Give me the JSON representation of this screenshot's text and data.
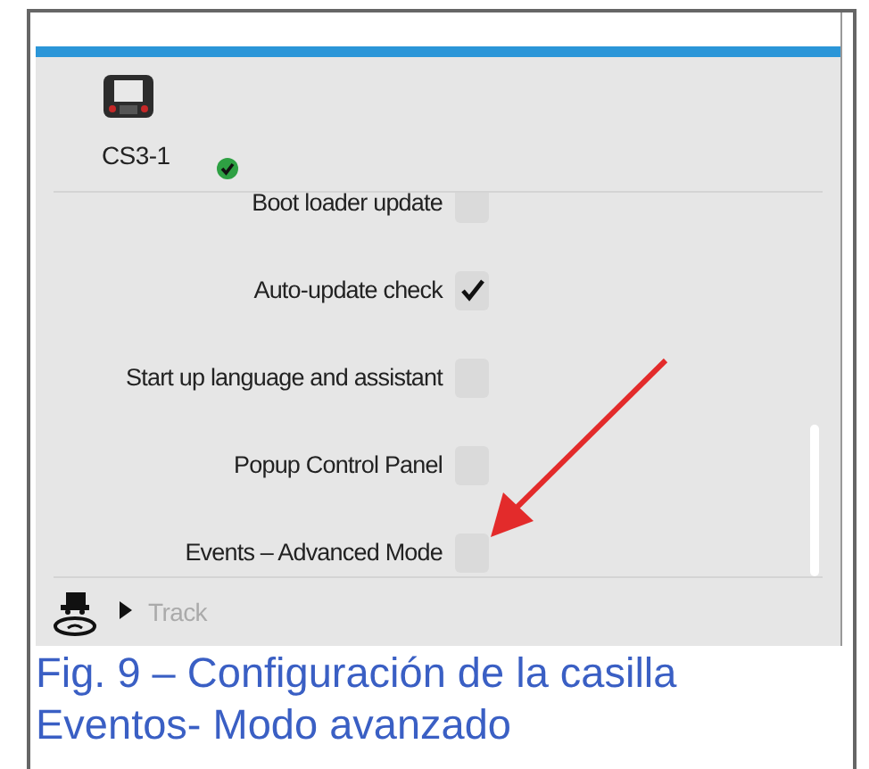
{
  "device": {
    "name": "CS3-1",
    "connected": true
  },
  "settings": [
    {
      "label": "Boot loader update",
      "checked": false
    },
    {
      "label": "Auto-update check",
      "checked": true
    },
    {
      "label": "Start up language and assistant",
      "checked": false
    },
    {
      "label": "Popup Control Panel",
      "checked": false
    },
    {
      "label": "Events – Advanced Mode",
      "checked": false
    }
  ],
  "nav": {
    "label": "Track",
    "expanded": false
  },
  "caption": [
    "Fig. 9 – Configuración de la casilla",
    "Eventos- Modo avanzado"
  ]
}
